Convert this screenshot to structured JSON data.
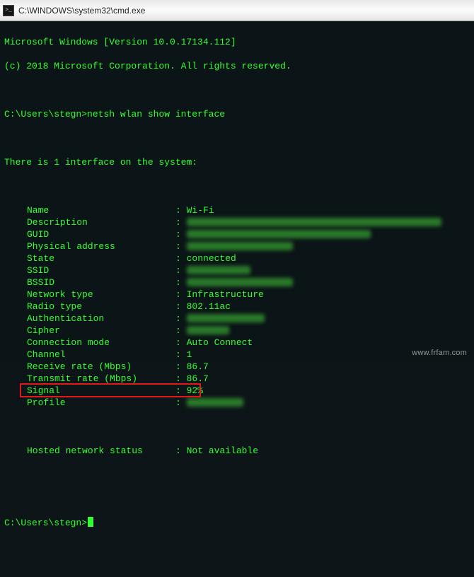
{
  "window": {
    "title": "C:\\WINDOWS\\system32\\cmd.exe"
  },
  "banner": {
    "line1": "Microsoft Windows [Version 10.0.17134.112]",
    "line2": "(c) 2018 Microsoft Corporation. All rights reserved."
  },
  "prompt": {
    "path": "C:\\Users\\stegn>",
    "command": "netsh wlan show interface"
  },
  "interface": {
    "header": "There is 1 interface on the system:",
    "rows": [
      {
        "label": "Name",
        "value": "Wi-Fi",
        "blurred": false
      },
      {
        "label": "Description",
        "value": "",
        "blurred": true,
        "blurWidth": "w-360"
      },
      {
        "label": "GUID",
        "value": "",
        "blurred": true,
        "blurWidth": "w-260"
      },
      {
        "label": "Physical address",
        "value": "",
        "blurred": true,
        "blurWidth": "w-150"
      },
      {
        "label": "State",
        "value": "connected",
        "blurred": false
      },
      {
        "label": "SSID",
        "value": "",
        "blurred": true,
        "blurWidth": "w-90"
      },
      {
        "label": "BSSID",
        "value": "",
        "blurred": true,
        "blurWidth": "w-150"
      },
      {
        "label": "Network type",
        "value": "Infrastructure",
        "blurred": false
      },
      {
        "label": "Radio type",
        "value": "802.11ac",
        "blurred": false
      },
      {
        "label": "Authentication",
        "value": "",
        "blurred": true,
        "blurWidth": "w-110"
      },
      {
        "label": "Cipher",
        "value": "",
        "blurred": true,
        "blurWidth": "w-60"
      },
      {
        "label": "Connection mode",
        "value": "Auto Connect",
        "blurred": false
      },
      {
        "label": "Channel",
        "value": "1",
        "blurred": false
      },
      {
        "label": "Receive rate (Mbps)",
        "value": "86.7",
        "blurred": false
      },
      {
        "label": "Transmit rate (Mbps)",
        "value": "86.7",
        "blurred": false
      },
      {
        "label": "Signal",
        "value": "92%",
        "blurred": false,
        "highlight": true
      },
      {
        "label": "Profile",
        "value": "",
        "blurred": true,
        "blurWidth": "w-80"
      }
    ],
    "hosted": {
      "label": "Hosted network status",
      "value": "Not available"
    }
  },
  "watermark": "www.frfam.com"
}
